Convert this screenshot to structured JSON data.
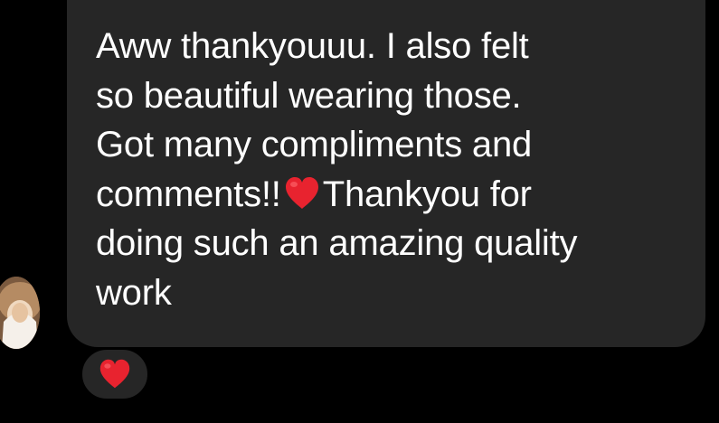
{
  "message": {
    "line_1": "Aww thankyouuu. I also felt",
    "line_2": "so beautiful wearing those.",
    "line_3": "Got many compliments and",
    "line_4a": "comments!!",
    "line_4b": "Thankyou for",
    "line_5": "doing such an amazing quality",
    "line_6": "work",
    "inline_emoji": "red-heart-icon"
  },
  "reaction": {
    "emoji": "red-heart-icon"
  },
  "colors": {
    "background": "#000000",
    "bubble": "#262626",
    "text": "#ffffff",
    "heart": "#e8232f"
  }
}
